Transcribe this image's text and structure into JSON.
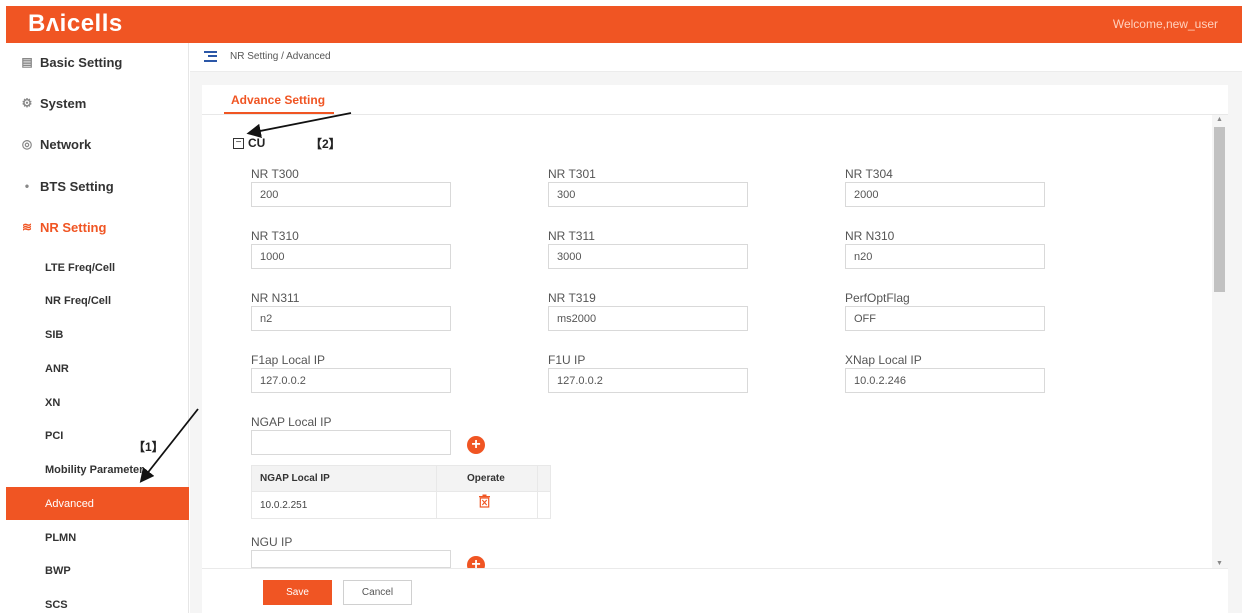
{
  "header": {
    "logo": "Bʌicells",
    "welcome": "Welcome,new_user"
  },
  "sidebar": {
    "main_items": [
      {
        "label": "Basic Setting",
        "icon": "document-icon"
      },
      {
        "label": "System",
        "icon": "gear-icon"
      },
      {
        "label": "Network",
        "icon": "globe-icon"
      },
      {
        "label": "BTS Setting",
        "icon": "antenna-icon"
      },
      {
        "label": "NR Setting",
        "icon": "signal-icon"
      }
    ],
    "sub_items": [
      "LTE Freq/Cell",
      "NR Freq/Cell",
      "SIB",
      "ANR",
      "XN",
      "PCI",
      "Mobility Parameter",
      "Advanced",
      "PLMN",
      "BWP",
      "SCS"
    ],
    "active_sub": "Advanced"
  },
  "breadcrumb": "NR Setting / Advanced",
  "tab": {
    "label": "Advance Setting"
  },
  "section": {
    "title": "CU"
  },
  "annotations": {
    "a1": "【1】",
    "a2": "【2】"
  },
  "fields": [
    {
      "label": "NR T300",
      "value": "200"
    },
    {
      "label": "NR T301",
      "value": "300"
    },
    {
      "label": "NR T304",
      "value": "2000"
    },
    {
      "label": "NR T310",
      "value": "1000"
    },
    {
      "label": "NR T311",
      "value": "3000"
    },
    {
      "label": "NR N310",
      "value": "n20"
    },
    {
      "label": "NR N311",
      "value": "n2"
    },
    {
      "label": "NR T319",
      "value": "ms2000"
    },
    {
      "label": "PerfOptFlag",
      "value": "OFF"
    },
    {
      "label": "F1ap Local IP",
      "value": "127.0.0.2"
    },
    {
      "label": "F1U IP",
      "value": "127.0.0.2"
    },
    {
      "label": "XNap Local IP",
      "value": "10.0.2.246"
    }
  ],
  "ngap": {
    "label": "NGAP Local IP",
    "value": "",
    "table": {
      "headers": [
        "NGAP Local IP",
        "Operate"
      ],
      "rows": [
        [
          "10.0.2.251"
        ]
      ]
    }
  },
  "ngu": {
    "label": "NGU IP",
    "value": ""
  },
  "buttons": {
    "save": "Save",
    "cancel": "Cancel"
  },
  "colors": {
    "accent": "#f05523",
    "breadcrumb_icon": "#2b57a7"
  }
}
